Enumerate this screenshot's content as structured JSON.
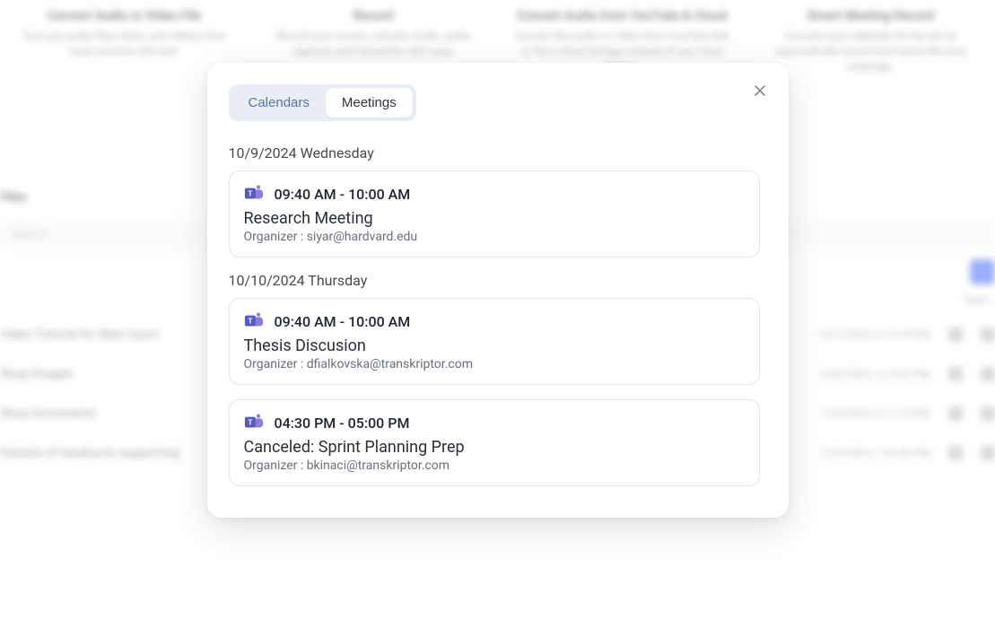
{
  "background": {
    "cards": [
      {
        "title": "Convert Audio or Video File",
        "desc": "Turn you audio files, texts, and videos from many sources into text."
      },
      {
        "title": "Record",
        "desc": "Record your screen, camera, audio, audio captures and transcribe with ease."
      },
      {
        "title": "Convert Audio from YouTube & Cloud",
        "desc": "Convert the audio or video from YouTube link or from cloud storage instead of your local storage."
      },
      {
        "title": "Smart Meeting Record",
        "desc": "Connect your calendar for the bot to automatically record and transcribe your meetings."
      }
    ],
    "section_label": "Files",
    "search_placeholder": "Search...",
    "sort": "Date ↓",
    "rows": [
      {
        "name": "Video Tutorial for New Users",
        "date": "9/27/2024, 4:15:10 PM"
      },
      {
        "name": "Shop Images",
        "date": "9/26/2024, 3:16:00 PM"
      },
      {
        "name": "Shop Documents",
        "date": "7/24/2024, 5:11:12 PM"
      },
      {
        "name": "Parents of newborns supporting",
        "date": "7/23/2024, 7:32:30 PM"
      }
    ]
  },
  "modal": {
    "tabs": {
      "calendars": "Calendars",
      "meetings": "Meetings",
      "active": "meetings"
    },
    "days": [
      {
        "header": "10/9/2024 Wednesday",
        "meetings": [
          {
            "time": "09:40 AM - 10:00 AM",
            "title": "Research Meeting",
            "organizer": "Organizer : siyar@hardvard.edu"
          }
        ]
      },
      {
        "header": "10/10/2024 Thursday",
        "meetings": [
          {
            "time": "09:40 AM - 10:00 AM",
            "title": "Thesis Discusion",
            "organizer": "Organizer : dfialkovska@transkriptor.com"
          },
          {
            "time": "04:30 PM - 05:00 PM",
            "title": "Canceled: Sprint Planning Prep",
            "organizer": "Organizer : bkinaci@transkriptor.com"
          }
        ]
      }
    ]
  }
}
